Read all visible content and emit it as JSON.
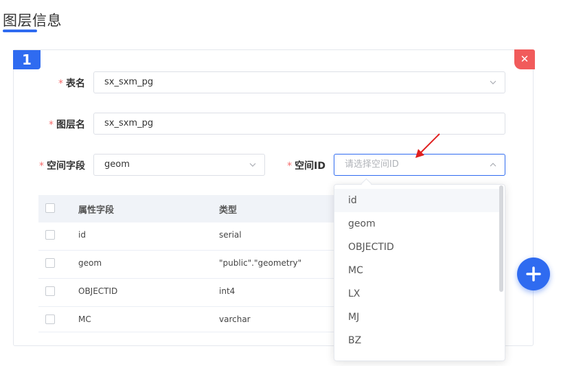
{
  "page": {
    "title": "图层信息"
  },
  "card": {
    "index": "1",
    "close_icon": "close-icon"
  },
  "form": {
    "table_name": {
      "label": "表名",
      "value": "sx_sxm_pg"
    },
    "layer_name": {
      "label": "图层名",
      "value": "sx_sxm_pg"
    },
    "spatial_field": {
      "label": "空间字段",
      "value": "geom"
    },
    "spatial_id": {
      "label": "空间ID",
      "placeholder": "请选择空间ID"
    }
  },
  "table": {
    "headers": {
      "field": "属性字段",
      "type": "类型"
    },
    "rows": [
      {
        "field": "id",
        "type": "serial"
      },
      {
        "field": "geom",
        "type": "\"public\".\"geometry\""
      },
      {
        "field": "OBJECTID",
        "type": "int4"
      },
      {
        "field": "MC",
        "type": "varchar"
      }
    ]
  },
  "dropdown": {
    "options": [
      "id",
      "geom",
      "OBJECTID",
      "MC",
      "LX",
      "MJ",
      "BZ"
    ],
    "highlighted": "id"
  },
  "colors": {
    "accent": "#2f6bf0",
    "danger": "#f15b5b",
    "required": "#f56c6c",
    "annotation_arrow": "#e02020"
  },
  "fab": {
    "icon": "plus-icon"
  }
}
